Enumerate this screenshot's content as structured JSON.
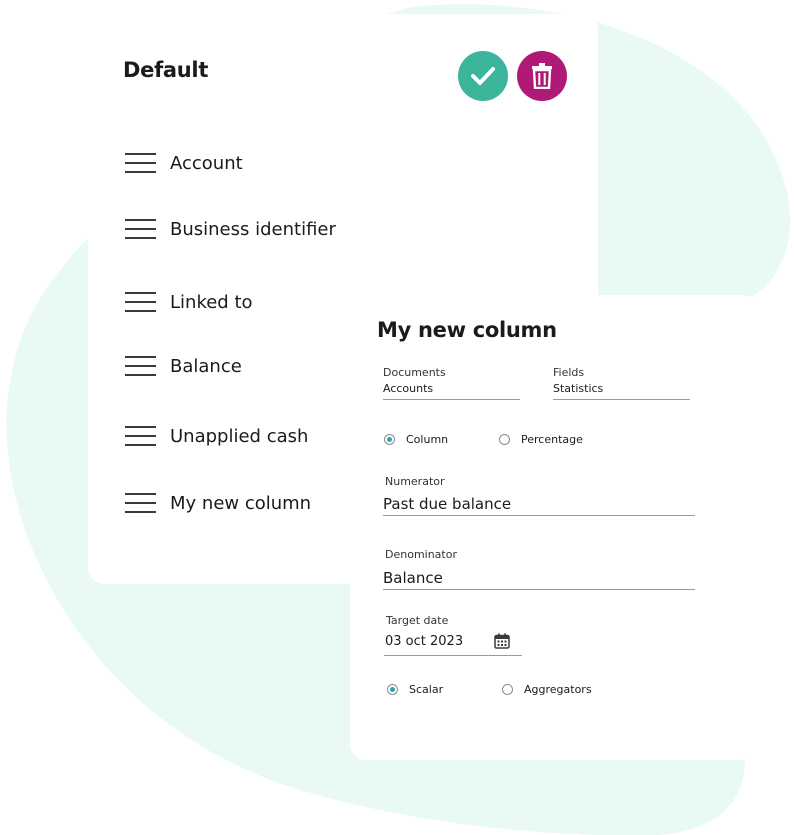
{
  "colors": {
    "background_blob": "#e9faf6",
    "confirm": "#3bb59c",
    "delete": "#b01a77",
    "radio_accent": "#2aa3b8"
  },
  "left_panel": {
    "title": "Default",
    "confirm_icon": "check-icon",
    "delete_icon": "trash-icon",
    "items": [
      {
        "label": "Account"
      },
      {
        "label": "Business identifier"
      },
      {
        "label": "Linked to"
      },
      {
        "label": "Balance"
      },
      {
        "label": "Unapplied cash"
      },
      {
        "label": "My new column"
      }
    ]
  },
  "right_panel": {
    "title": "My new column",
    "documents": {
      "label": "Documents",
      "value": "Accounts"
    },
    "fields": {
      "label": "Fields",
      "value": "Statistics"
    },
    "type_options": [
      {
        "label": "Column",
        "selected": true
      },
      {
        "label": "Percentage",
        "selected": false
      }
    ],
    "numerator": {
      "label": "Numerator",
      "value": "Past due balance"
    },
    "denominator": {
      "label": "Denominator",
      "value": "Balance"
    },
    "target_date": {
      "label": "Target date",
      "value": "03 oct 2023",
      "icon": "calendar-icon"
    },
    "mode_options": [
      {
        "label": "Scalar",
        "selected": true
      },
      {
        "label": "Aggregators",
        "selected": false
      }
    ]
  }
}
